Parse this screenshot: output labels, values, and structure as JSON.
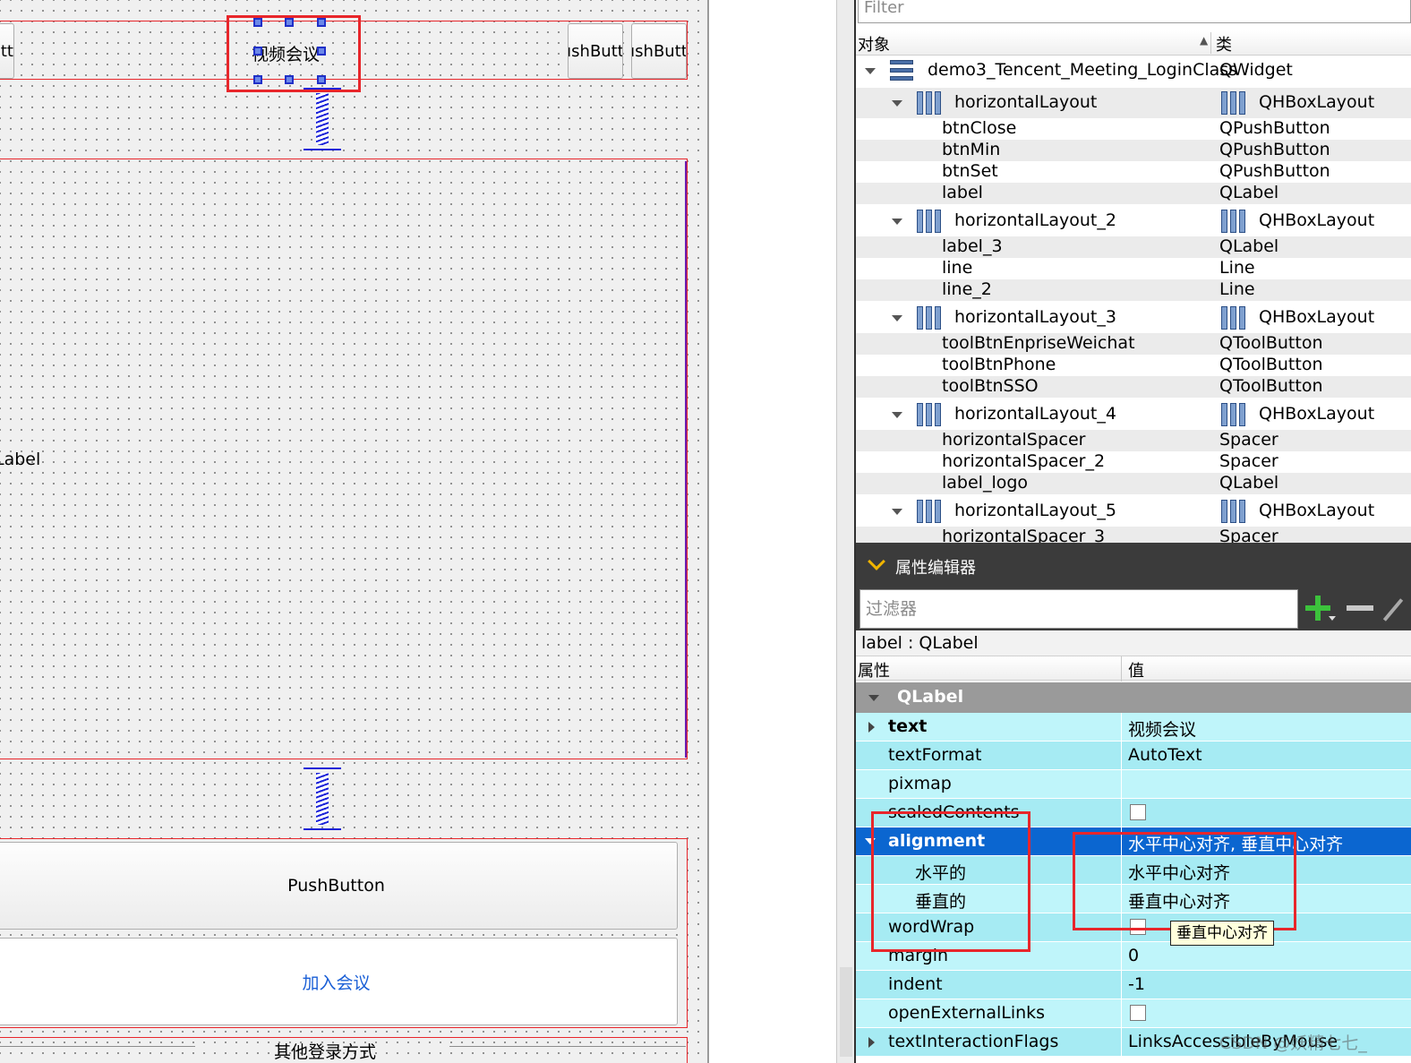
{
  "canvas": {
    "btn_left_text": "tt",
    "title_label": "视频会议",
    "btn_right1": "ıshButt",
    "btn_right2": "ıshButt",
    "big_label": "Label",
    "push_button": "PushButton",
    "join_button": "加入会议",
    "other_login": "其他登录方式",
    "link_color": "#1a5fd6"
  },
  "object_inspector": {
    "filter_placeholder": "Filter",
    "col_object": "对象",
    "col_class": "类",
    "rows": [
      {
        "name": "demo3_Tencent_Meeting_LoginClass",
        "cls": "QWidget"
      },
      {
        "name": "horizontalLayout",
        "cls": "QHBoxLayout"
      },
      {
        "name": "btnClose",
        "cls": "QPushButton"
      },
      {
        "name": "btnMin",
        "cls": "QPushButton"
      },
      {
        "name": "btnSet",
        "cls": "QPushButton"
      },
      {
        "name": "label",
        "cls": "QLabel"
      },
      {
        "name": "horizontalLayout_2",
        "cls": "QHBoxLayout"
      },
      {
        "name": "label_3",
        "cls": "QLabel"
      },
      {
        "name": "line",
        "cls": "Line"
      },
      {
        "name": "line_2",
        "cls": "Line"
      },
      {
        "name": "horizontalLayout_3",
        "cls": "QHBoxLayout"
      },
      {
        "name": "toolBtnEnpriseWeichat",
        "cls": "QToolButton"
      },
      {
        "name": "toolBtnPhone",
        "cls": "QToolButton"
      },
      {
        "name": "toolBtnSSO",
        "cls": "QToolButton"
      },
      {
        "name": "horizontalLayout_4",
        "cls": "QHBoxLayout"
      },
      {
        "name": "horizontalSpacer",
        "cls": "Spacer"
      },
      {
        "name": "horizontalSpacer_2",
        "cls": "Spacer"
      },
      {
        "name": "label_logo",
        "cls": "QLabel"
      },
      {
        "name": "horizontalLayout_5",
        "cls": "QHBoxLayout"
      },
      {
        "name": "horizontalSpacer_3",
        "cls": "Spacer"
      }
    ]
  },
  "property_editor": {
    "title": "属性编辑器",
    "filter_placeholder": "过滤器",
    "object_line": "label : QLabel",
    "col_property": "属性",
    "col_value": "值",
    "group": "QLabel",
    "rows": [
      {
        "name": "text",
        "value": "视频会议"
      },
      {
        "name": "textFormat",
        "value": "AutoText"
      },
      {
        "name": "pixmap",
        "value": ""
      },
      {
        "name": "scaledContents",
        "value": ""
      },
      {
        "name": "alignment",
        "value": "水平中心对齐, 垂直中心对齐"
      },
      {
        "name": "水平的",
        "value": "水平中心对齐"
      },
      {
        "name": "垂直的",
        "value": "垂直中心对齐"
      },
      {
        "name": "wordWrap",
        "value": ""
      },
      {
        "name": "margin",
        "value": "0"
      },
      {
        "name": "indent",
        "value": "-1"
      },
      {
        "name": "openExternalLinks",
        "value": ""
      },
      {
        "name": "textInteractionFlags",
        "value": "LinksAccessibleByMouse"
      }
    ],
    "tooltip": "垂直中心对齐",
    "watermark": "CSDN @妖精七七_"
  }
}
